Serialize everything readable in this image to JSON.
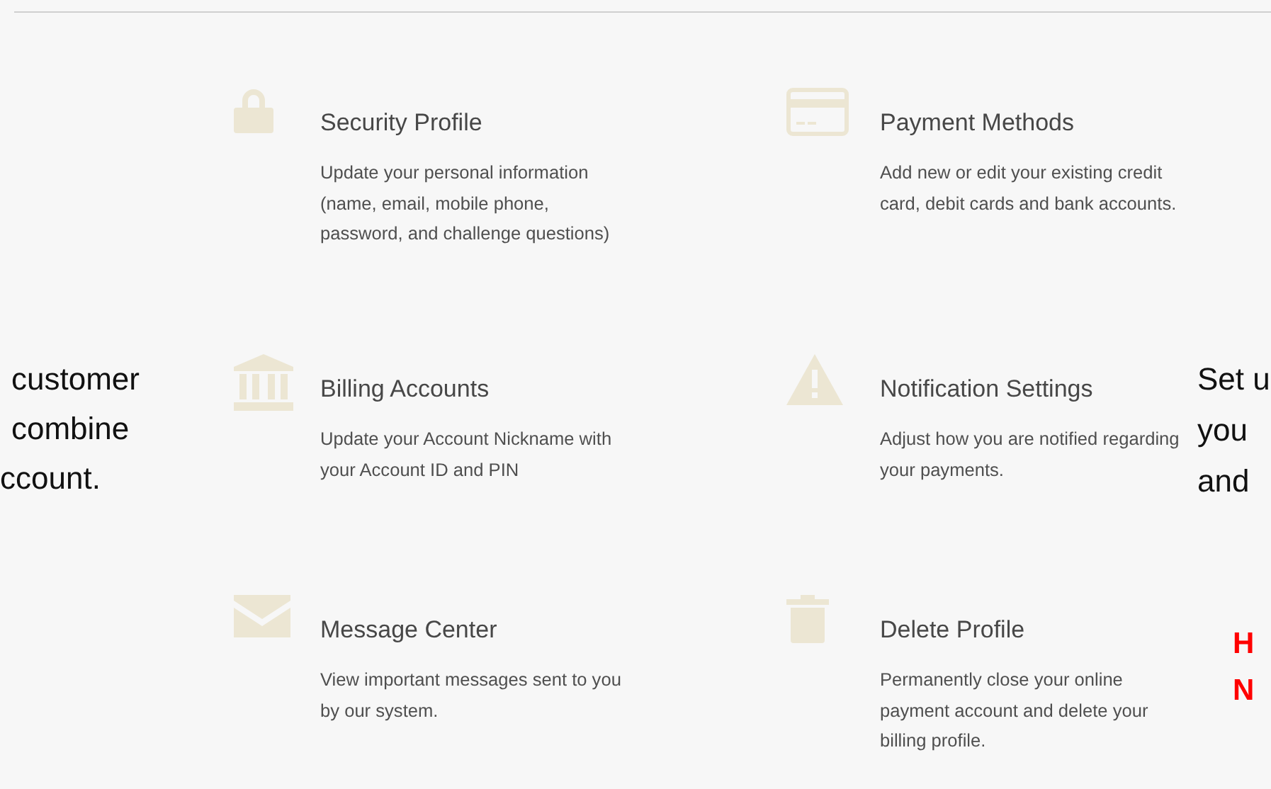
{
  "left_note": {
    "lines": [
      "customer",
      "combine",
      "ccount."
    ]
  },
  "options": [
    {
      "title": "Security Profile",
      "description": "Update your personal information (name, email, mobile phone, password, and challenge questions)"
    },
    {
      "title": "Payment Methods",
      "description": "Add new or edit your existing credit card, debit cards and bank accounts."
    },
    {
      "title": "Billing Accounts",
      "description": "Update your Account Nickname with your Account ID and PIN"
    },
    {
      "title": "Notification Settings",
      "description": "Adjust how you are notified regarding your payments."
    },
    {
      "title": "Message Center",
      "description": "View important messages sent to you by our system."
    },
    {
      "title": "Delete Profile",
      "description": "Permanently close your online payment account and delete your billing profile."
    }
  ],
  "right_note": {
    "lines": [
      "Set u",
      "you",
      "and"
    ]
  },
  "right_alert": {
    "lines": [
      "H",
      "N"
    ]
  }
}
